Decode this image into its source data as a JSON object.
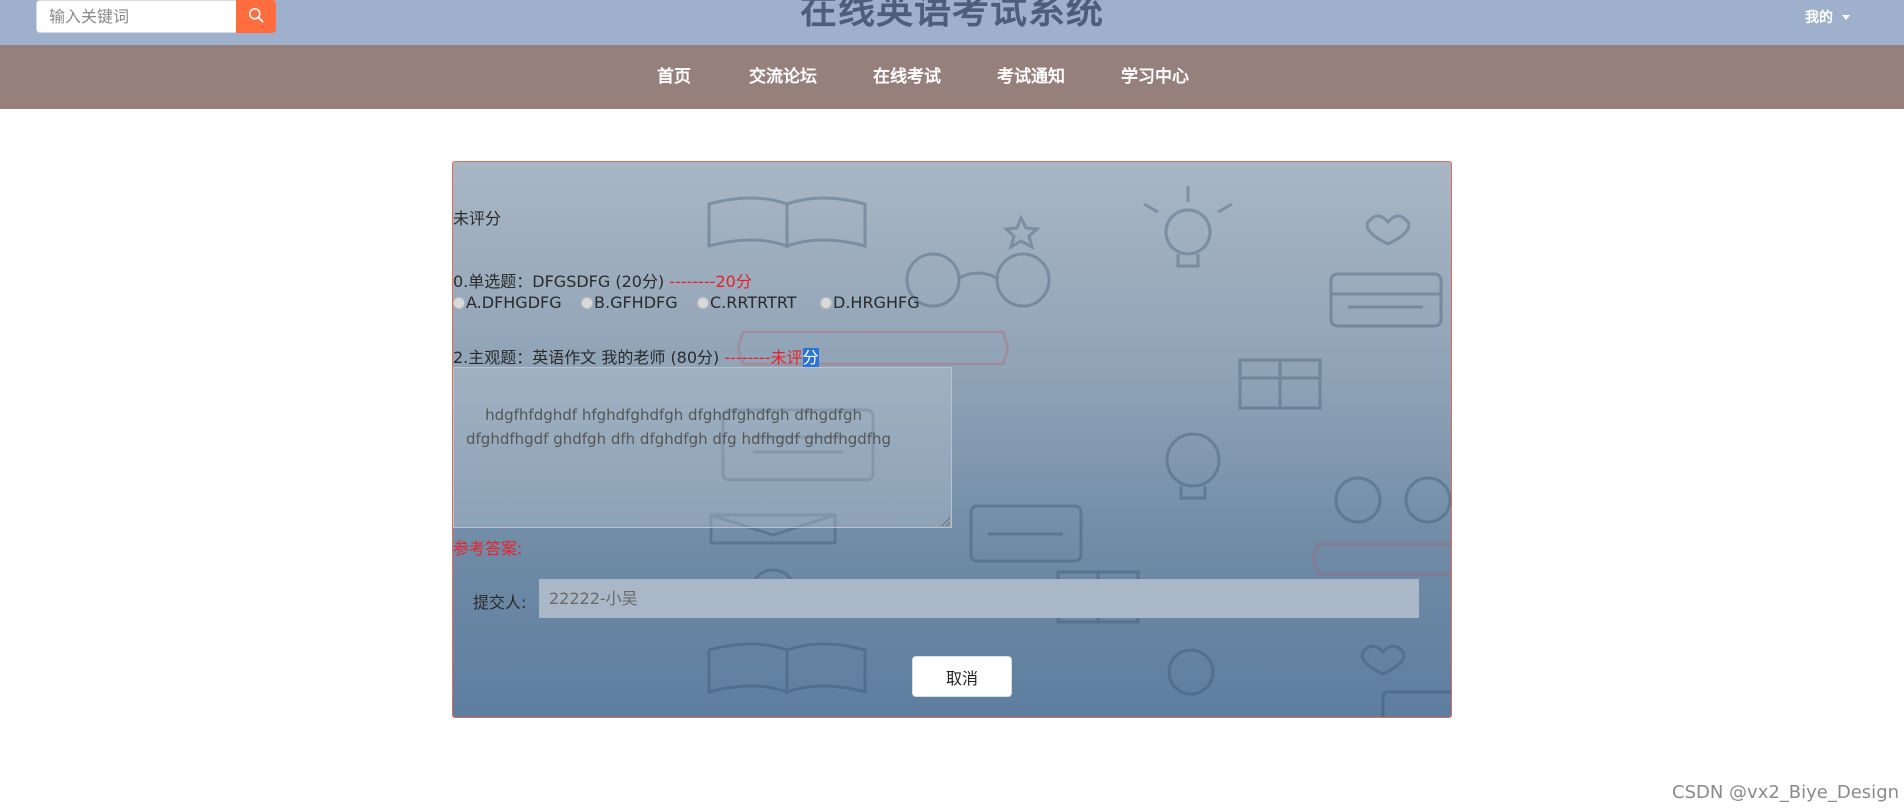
{
  "header": {
    "search_placeholder": "输入关键词",
    "site_title": "在线英语考试系统",
    "user_menu_label": "我的"
  },
  "nav": {
    "items": [
      "首页",
      "交流论坛",
      "在线考试",
      "考试通知",
      "学习中心"
    ]
  },
  "exam": {
    "status": "未评分",
    "q1": {
      "title": "0.单选题：DFGSDFG (20分)",
      "score_note": "--------20分",
      "options": [
        "A.DFHGDFG",
        "B.GFHDFG",
        "C.RRTRTRT",
        "D.HRGHFG"
      ]
    },
    "q2": {
      "title": "2.主观题：英语作文 我的老师 (80分)",
      "score_note_a": "--------未评",
      "score_note_b": "分",
      "answer": "hdgfhfdghdf hfghdfghdfgh dfghdfghdfgh dfhgdfgh dfghdfhgdf ghdfgh dfh dfghdfgh dfg hdfhgdf ghdfhgdfhg"
    },
    "reference_label": "参考答案:",
    "submitter_label": "提交人:",
    "submitter_value": "22222-小吴",
    "cancel_label": "取消"
  },
  "watermark": "CSDN @vx2_Biye_Design",
  "colors": {
    "topbar": "#9fb0cc",
    "navbar": "#95807c",
    "search_button": "#ff6d3f",
    "score_red": "#e8202a",
    "panel_border": "#e06a55"
  }
}
